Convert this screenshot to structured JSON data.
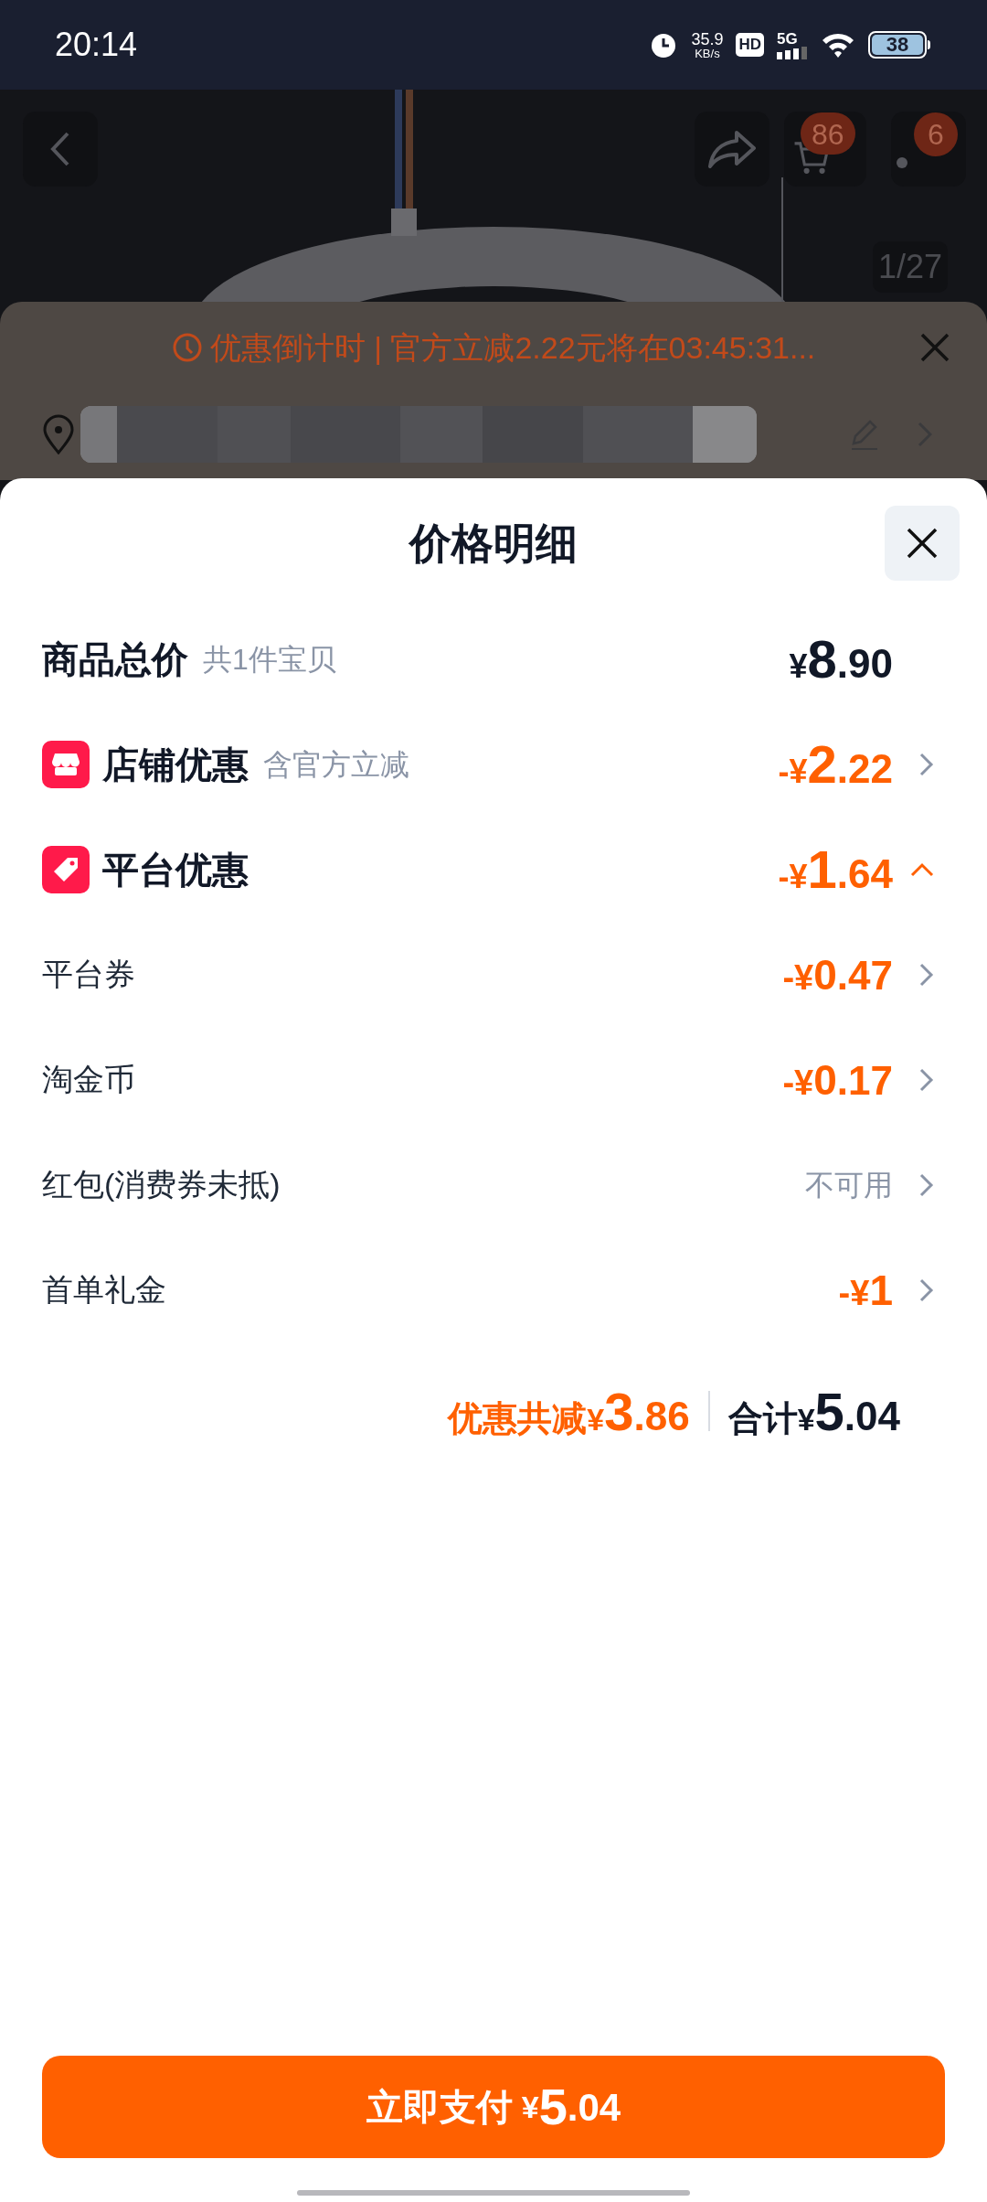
{
  "status_bar": {
    "time": "20:14",
    "speed": "35.9",
    "speed_unit": "KB/s",
    "hd": "HD",
    "network": "5G",
    "battery": "38"
  },
  "product_page": {
    "cart_badge": "86",
    "more_badge": "6",
    "image_counter": "1/27"
  },
  "promo_banner": {
    "text": "优惠倒计时 | 官方立减2.22元将在03:45:31..."
  },
  "sheet": {
    "title": "价格明细",
    "rows": [
      {
        "kind": "total",
        "label": "商品总价",
        "note": "共1件宝贝",
        "amount": "¥8.90"
      },
      {
        "kind": "store",
        "label": "店铺优惠",
        "note": "含官方立减",
        "amount": "-¥2.22",
        "expanded": false
      },
      {
        "kind": "tag",
        "label": "平台优惠",
        "amount": "-¥1.64",
        "expanded": true,
        "children": [
          {
            "kind": "deduction",
            "label": "平台券",
            "amount": "-¥0.47"
          },
          {
            "kind": "deduction",
            "label": "淘金币",
            "amount": "-¥0.17"
          },
          {
            "kind": "unavailable",
            "label": "红包(消费券未抵)",
            "amount": "不可用"
          },
          {
            "kind": "deduction",
            "label": "首单礼金",
            "amount": "-¥1"
          }
        ]
      }
    ],
    "summary": {
      "discount_label": "优惠共减",
      "discount": "¥3.86",
      "total_label": "合计",
      "total": "¥5.04"
    },
    "pay_button": {
      "label": "立即支付",
      "amount": "¥5.04"
    }
  }
}
